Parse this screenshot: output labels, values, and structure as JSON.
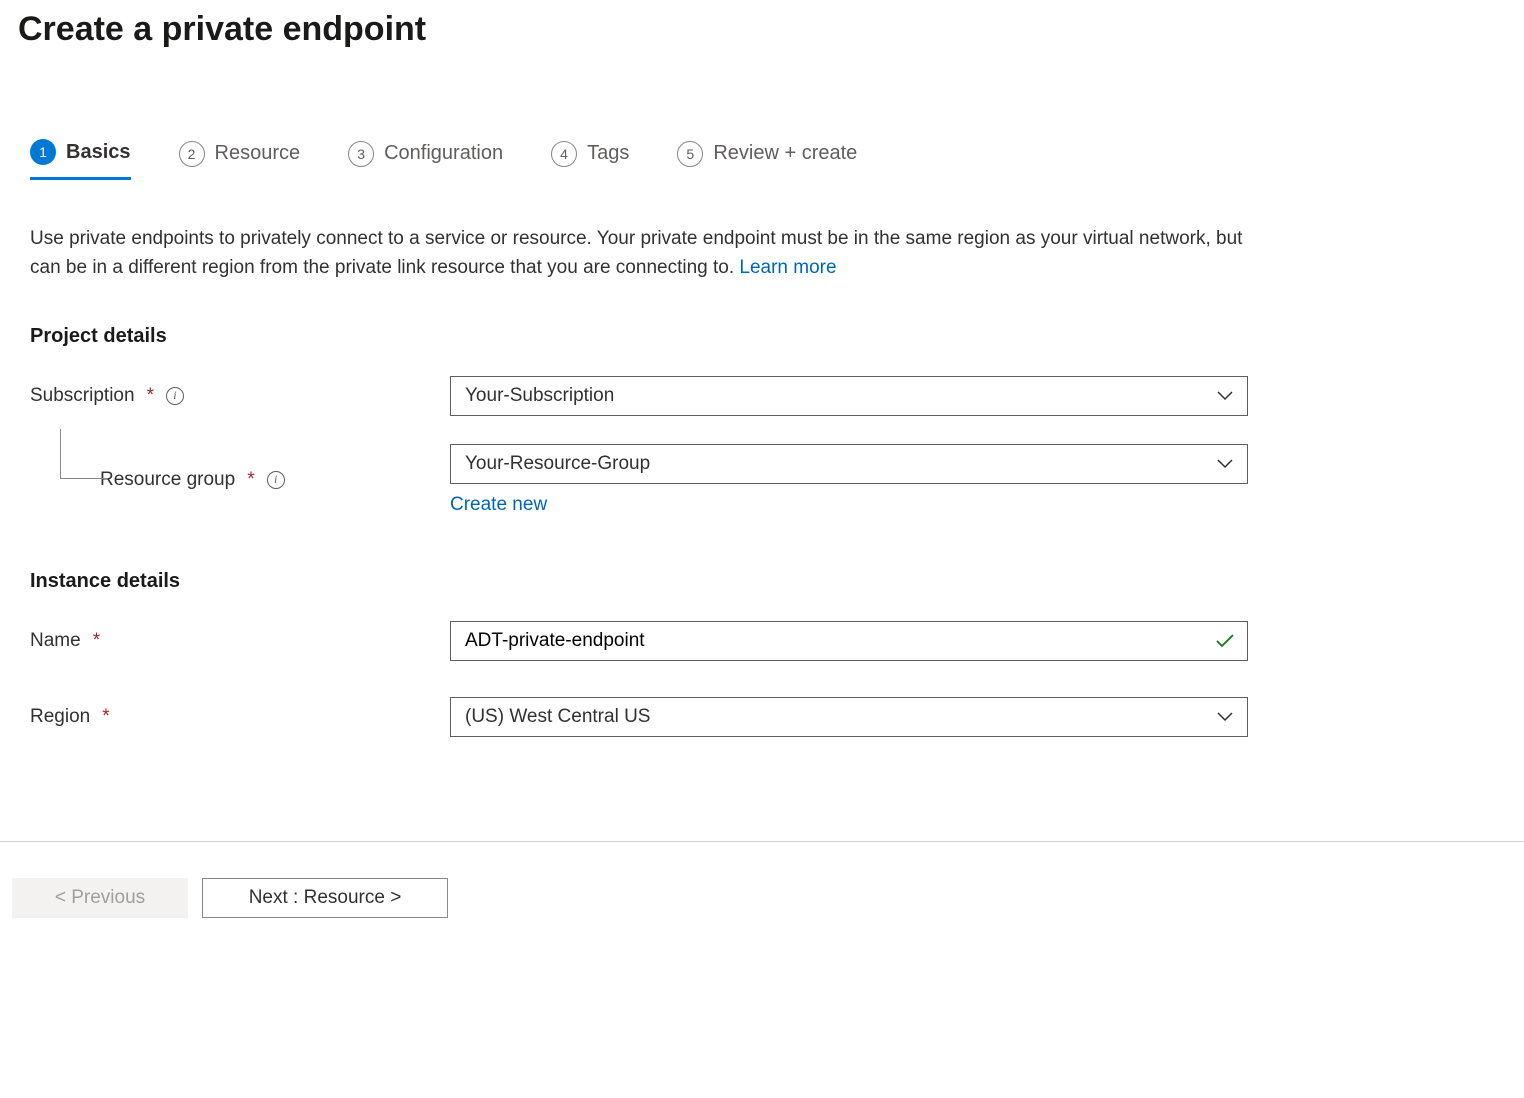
{
  "header": {
    "title": "Create a private endpoint"
  },
  "tabs": [
    {
      "number": "1",
      "label": "Basics",
      "active": true
    },
    {
      "number": "2",
      "label": "Resource",
      "active": false
    },
    {
      "number": "3",
      "label": "Configuration",
      "active": false
    },
    {
      "number": "4",
      "label": "Tags",
      "active": false
    },
    {
      "number": "5",
      "label": "Review + create",
      "active": false
    }
  ],
  "description": {
    "text": "Use private endpoints to privately connect to a service or resource. Your private endpoint must be in the same region as your virtual network, but can be in a different region from the private link resource that you are connecting to.  ",
    "link_label": "Learn more"
  },
  "sections": {
    "project_details": {
      "title": "Project details",
      "subscription_label": "Subscription",
      "subscription_value": "Your-Subscription",
      "resource_group_label": "Resource group",
      "resource_group_value": "Your-Resource-Group",
      "create_new_label": "Create new"
    },
    "instance_details": {
      "title": "Instance details",
      "name_label": "Name",
      "name_value": "ADT-private-endpoint",
      "region_label": "Region",
      "region_value": "(US) West Central US"
    }
  },
  "footer": {
    "previous_label": "< Previous",
    "next_label": "Next : Resource >"
  }
}
